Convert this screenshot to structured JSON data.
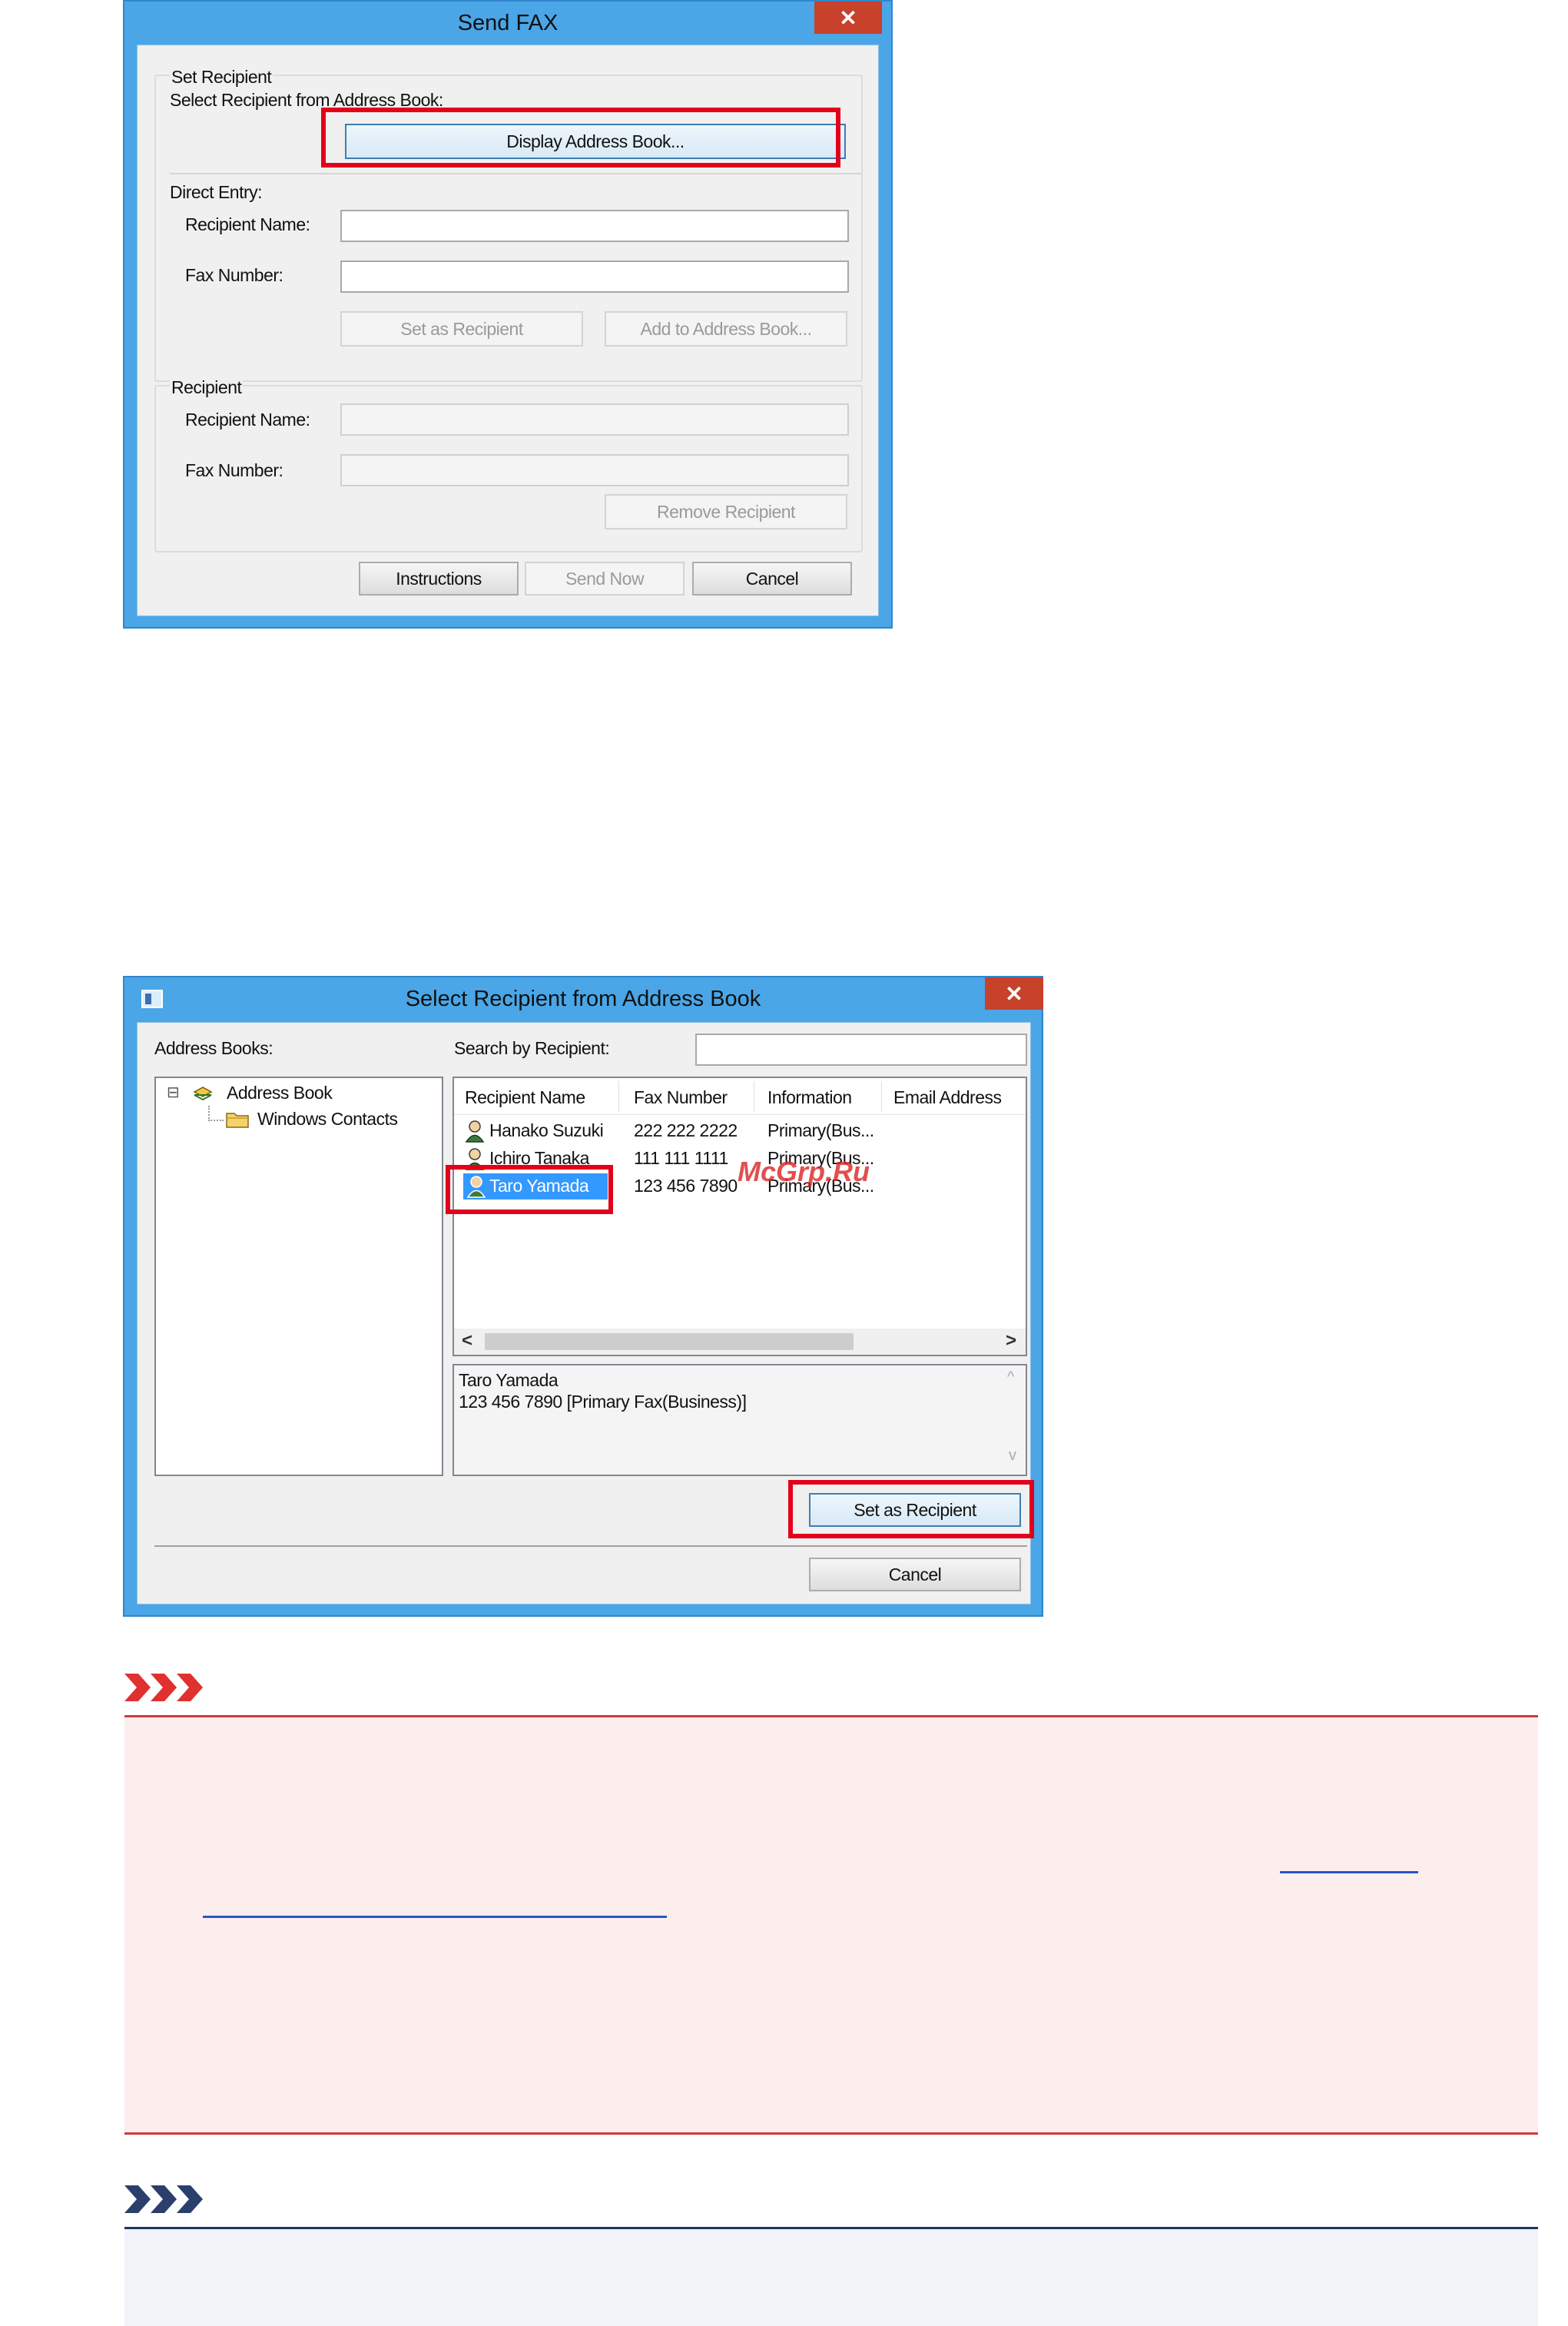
{
  "send_fax": {
    "title": "Send FAX",
    "close": "✕",
    "set_recipient": {
      "group_label": "Set Recipient",
      "select_from_label": "Select Recipient from Address Book:",
      "display_address_book": "Display Address Book..."
    },
    "direct_entry": {
      "label": "Direct Entry:",
      "recipient_name_label": "Recipient Name:",
      "recipient_name_value": "",
      "fax_number_label": "Fax Number:",
      "fax_number_value": "",
      "set_as_recipient": "Set as Recipient",
      "add_to_address_book": "Add to Address Book..."
    },
    "recipient": {
      "group_label": "Recipient",
      "recipient_name_label": "Recipient Name:",
      "fax_number_label": "Fax Number:",
      "remove_recipient": "Remove Recipient"
    },
    "buttons": {
      "instructions": "Instructions",
      "send_now": "Send Now",
      "cancel": "Cancel"
    }
  },
  "address_book": {
    "title": "Select Recipient from Address Book",
    "close": "✕",
    "address_books_label": "Address Books:",
    "tree": {
      "expander": "⊟",
      "root": "Address Book",
      "child": "Windows Contacts"
    },
    "search_label": "Search by Recipient:",
    "search_value": "",
    "columns": [
      "Recipient Name",
      "Fax Number",
      "Information",
      "Email Address"
    ],
    "rows": [
      {
        "name": "Hanako Suzuki",
        "fax": "222 222 2222",
        "info": "Primary(Bus..."
      },
      {
        "name": "Ichiro Tanaka",
        "fax": "111 111 1111",
        "info": "Primary(Bus..."
      },
      {
        "name": "Taro Yamada",
        "fax": "123 456 7890",
        "info": "Primary(Bus..."
      }
    ],
    "selected_row": 2,
    "scroll_left": "<",
    "scroll_right": ">",
    "scroll_up": "^",
    "scroll_down": "v",
    "detail_line1": "Taro Yamada",
    "detail_line2": "123 456 7890 [Primary Fax(Business)]",
    "set_as_recipient": "Set as Recipient",
    "cancel": "Cancel"
  },
  "watermark": "McGrp.Ru",
  "colors": {
    "highlight": "#e3001b",
    "important_bg": "#fdeeee",
    "important_line": "#d03a3a",
    "note_bg": "#f1f3f8",
    "note_line": "#1f3560",
    "link": "#2a55c8"
  }
}
